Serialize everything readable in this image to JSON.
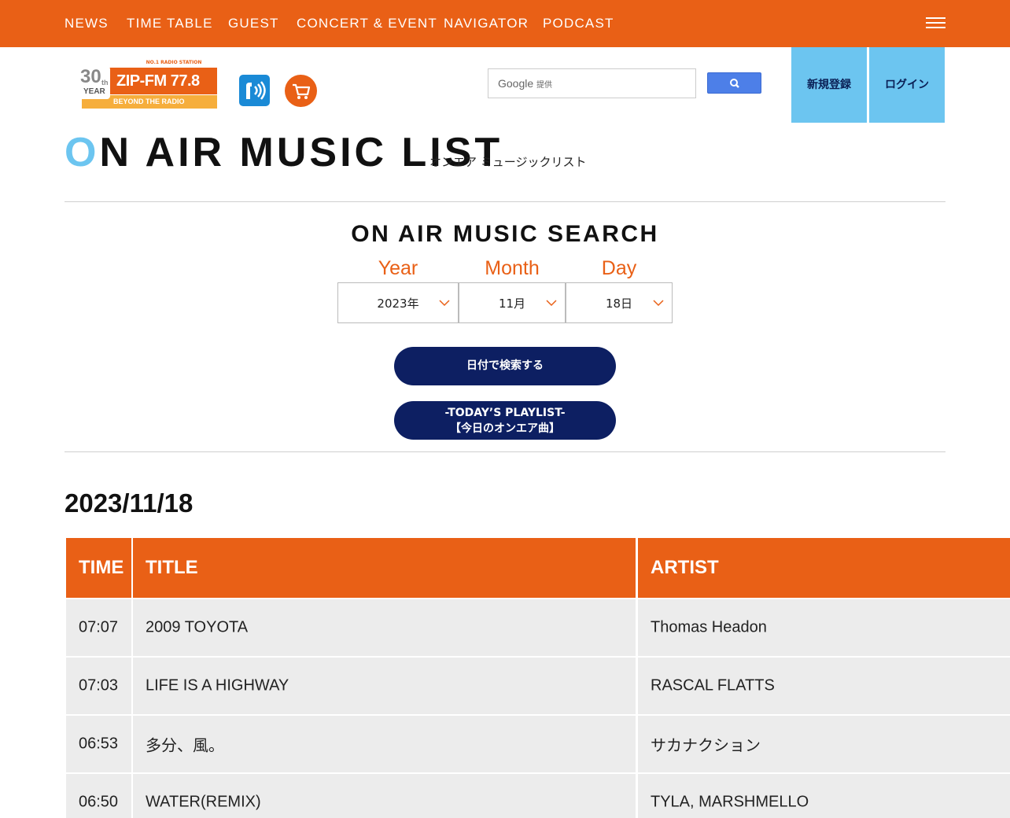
{
  "nav": {
    "items": [
      "NEWS",
      "TIME TABLE",
      "GUEST",
      "CONCERT & EVENT",
      "NAVIGATOR",
      "PODCAST"
    ]
  },
  "logo": {
    "tagline": "NO.1 RADIO STATION",
    "name": "ZIP-FM 77.8",
    "slogan": "BEYOND THE RADIO",
    "anniversary_number": "30",
    "anniversary_suffix": "th",
    "anniversary_word": "YEAR"
  },
  "search": {
    "placeholder_brand": "Google",
    "placeholder_suffix": "提供"
  },
  "account": {
    "register_label": "新規登録",
    "login_label": "ログイン"
  },
  "page": {
    "title_first": "O",
    "title_rest": "N AIR MUSIC LIST",
    "subtitle": "オンエア ミュージックリスト"
  },
  "music_search": {
    "heading": "ON AIR MUSIC SEARCH",
    "year_label": "Year",
    "month_label": "Month",
    "day_label": "Day",
    "year_value": "2023年",
    "month_value": "11月",
    "day_value": "18日",
    "search_button": "日付で検索する",
    "today_line1": "-TODAY’S PLAYLIST-",
    "today_line2": "【今日のオンエア曲】"
  },
  "playlist": {
    "date": "2023/11/18",
    "headers": {
      "time": "TIME",
      "title": "TITLE",
      "artist": "ARTIST"
    },
    "rows": [
      {
        "time": "07:07",
        "title": "2009 TOYOTA",
        "artist": "Thomas Headon"
      },
      {
        "time": "07:03",
        "title": "LIFE IS A HIGHWAY",
        "artist": "RASCAL FLATTS"
      },
      {
        "time": "06:53",
        "title": "多分、風。",
        "artist": "サカナクション"
      },
      {
        "time": "06:50",
        "title": "WATER(REMIX)",
        "artist": "TYLA, MARSHMELLO"
      }
    ]
  },
  "colors": {
    "brand_orange": "#e96016",
    "accent_blue": "#6cc5f0",
    "navy": "#0d1f62"
  }
}
